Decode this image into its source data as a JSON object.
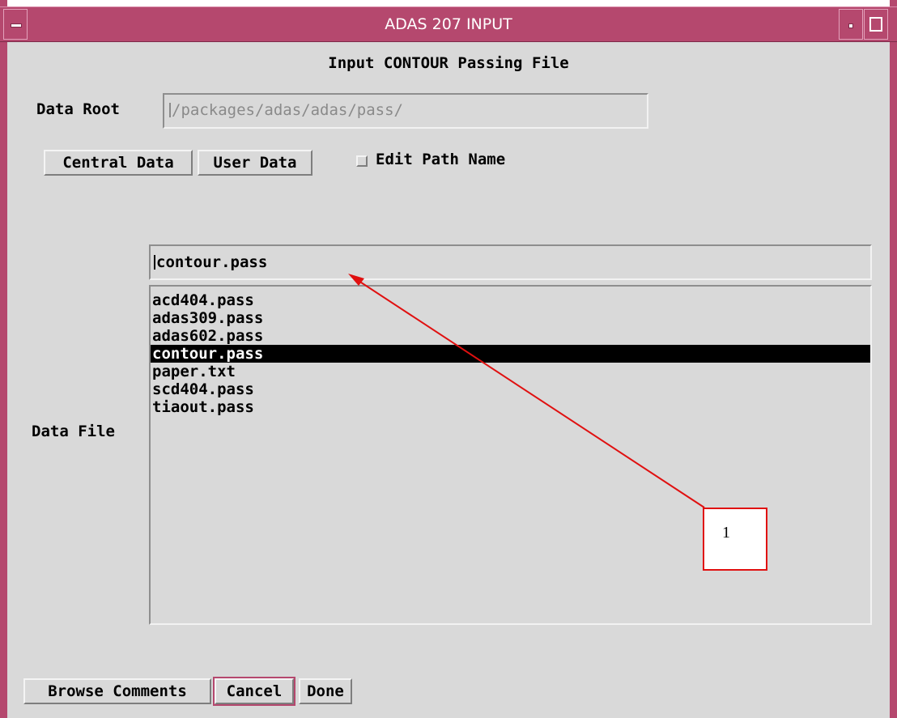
{
  "window": {
    "title": "ADAS 207 INPUT"
  },
  "form": {
    "heading": "Input CONTOUR Passing File",
    "data_root_label": "Data Root",
    "data_root_value": "/packages/adas/adas/pass/",
    "central_data_button": "Central Data",
    "user_data_button": "User Data",
    "edit_path_label": "Edit Path Name",
    "edit_path_checked": false,
    "data_file_label": "Data File",
    "data_file_value": "contour.pass",
    "files": [
      {
        "name": "acd404.pass",
        "selected": false
      },
      {
        "name": "adas309.pass",
        "selected": false
      },
      {
        "name": "adas602.pass",
        "selected": false
      },
      {
        "name": "contour.pass",
        "selected": true
      },
      {
        "name": "paper.txt",
        "selected": false
      },
      {
        "name": "scd404.pass",
        "selected": false
      },
      {
        "name": "tiaout.pass",
        "selected": false
      }
    ]
  },
  "buttons": {
    "browse_comments": "Browse Comments",
    "cancel": "Cancel",
    "done": "Done"
  },
  "annotation": {
    "label": "1",
    "color": "#e01010"
  },
  "colors": {
    "titlebar": "#b5486e",
    "background": "#d9d9d9"
  }
}
